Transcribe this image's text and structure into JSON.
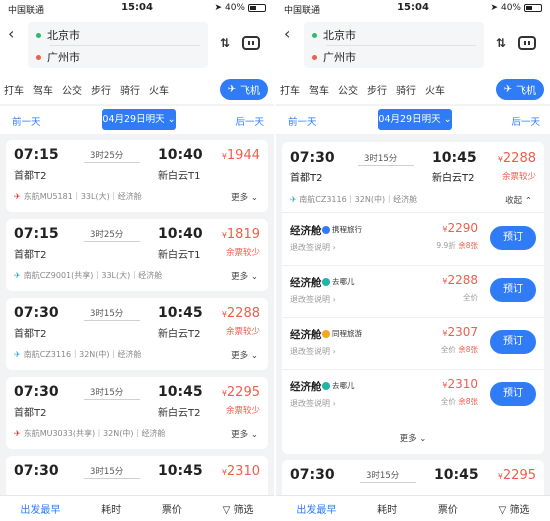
{
  "status": {
    "carrier": "中国联通",
    "time": "15:04",
    "battery": "40%"
  },
  "header": {
    "from": "北京市",
    "to": "广州市"
  },
  "tabs": [
    "打车",
    "驾车",
    "公交",
    "步行",
    "骑行",
    "火车",
    "飞机"
  ],
  "datebar": {
    "prev": "前一天",
    "date": "04月29日明天",
    "next": "后一天"
  },
  "bottombar": [
    "出发最早",
    "耗时",
    "票价",
    "筛选"
  ],
  "left_flights": [
    {
      "dep": "07:15",
      "dur": "3时25分",
      "arr": "10:40",
      "dep_t": "首都T2",
      "arr_t": "新白云T1",
      "price": "1944",
      "tag": "",
      "airline": "东航MU5181｜33L(大)｜经济舱",
      "more": "更多"
    },
    {
      "dep": "07:15",
      "dur": "3时25分",
      "arr": "10:40",
      "dep_t": "首都T2",
      "arr_t": "新白云T1",
      "price": "1819",
      "tag": "余票较少",
      "airline": "南航CZ9001(共享)｜33L(大)｜经济舱",
      "more": "更多"
    },
    {
      "dep": "07:30",
      "dur": "3时15分",
      "arr": "10:45",
      "dep_t": "首都T2",
      "arr_t": "新白云T2",
      "price": "2288",
      "tag": "余票较少",
      "airline": "南航CZ3116｜32N(中)｜经济舱",
      "more": "更多"
    },
    {
      "dep": "07:30",
      "dur": "3时15分",
      "arr": "10:45",
      "dep_t": "首都T2",
      "arr_t": "新白云T2",
      "price": "2295",
      "tag": "余票较少",
      "airline": "东航MU3033(共享)｜32N(中)｜经济舱",
      "more": "更多"
    },
    {
      "dep": "07:30",
      "dur": "3时15分",
      "arr": "10:45",
      "dep_t": "首都T2",
      "arr_t": "新白云T2",
      "price": "2310",
      "tag": "",
      "airline": "",
      "more": ""
    }
  ],
  "detail": {
    "dep": "07:30",
    "dur": "3时15分",
    "arr": "10:45",
    "dep_t": "首都T2",
    "arr_t": "新白云T2",
    "price": "2288",
    "tag": "余票较少",
    "airline": "南航CZ3116｜32N(中)｜经济舱",
    "collapse": "收起",
    "cabins": [
      {
        "name": "经济舱",
        "agent": "携程旅行",
        "rule": "退改签说明",
        "price": "2290",
        "disc": "9.9折",
        "left": "余8张",
        "book": "预订"
      },
      {
        "name": "经济舱",
        "agent": "去哪儿",
        "rule": "退改签说明",
        "price": "2288",
        "disc": "全价",
        "left": "",
        "book": "预订"
      },
      {
        "name": "经济舱",
        "agent": "同程旅游",
        "rule": "退改签说明",
        "price": "2307",
        "disc": "全价",
        "left": "余8张",
        "book": "预订"
      },
      {
        "name": "经济舱",
        "agent": "去哪儿",
        "rule": "退改签说明",
        "price": "2310",
        "disc": "全价",
        "left": "余8张",
        "book": "预订"
      }
    ],
    "more": "更多"
  },
  "right_next": {
    "dep": "07:30",
    "dur": "3时15分",
    "arr": "10:45",
    "price": "2295"
  },
  "colors": {
    "accent": "#2f7cf6",
    "price": "#f25c4c"
  }
}
